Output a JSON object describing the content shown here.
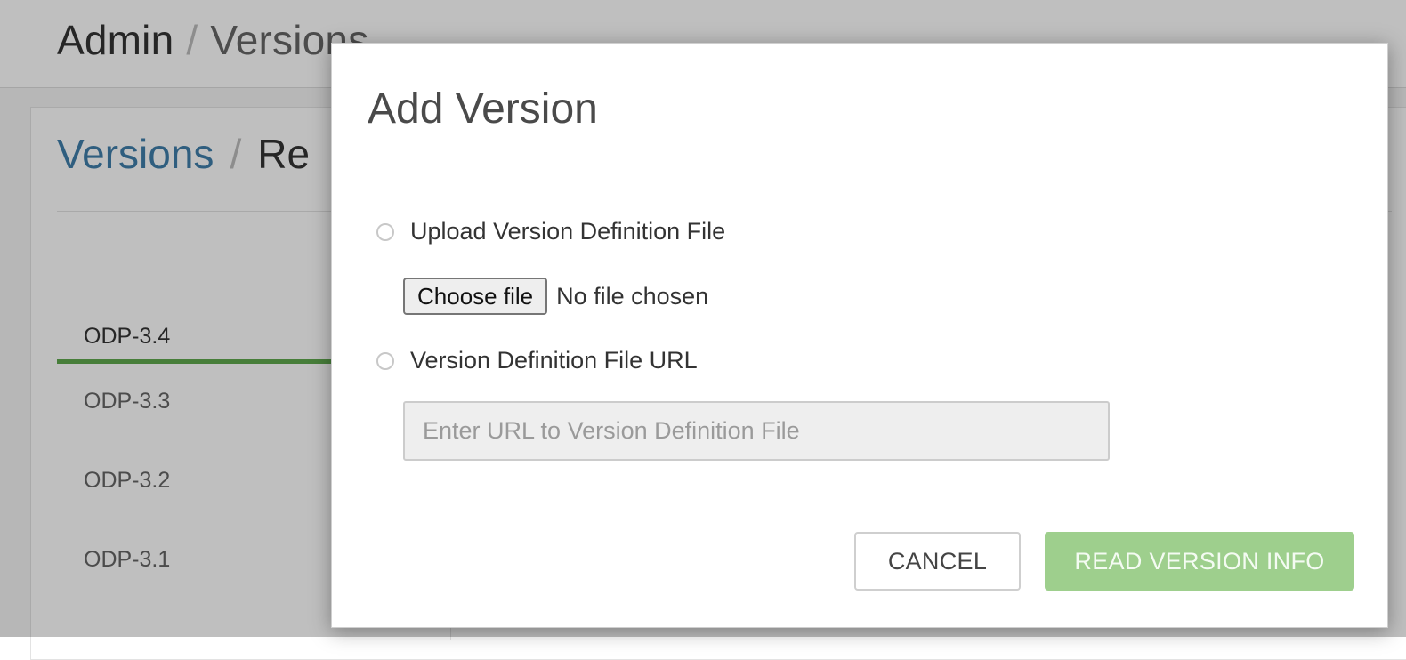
{
  "header": {
    "crumb_root": "Admin",
    "crumb_separator": "/",
    "crumb_current": "Versions"
  },
  "panel": {
    "crumb_link": "Versions",
    "crumb_separator": "/",
    "crumb_current": "Re"
  },
  "stack_tabs": [
    {
      "label": "ODP-3.4",
      "active": true
    },
    {
      "label": "ODP-3.3",
      "active": false
    },
    {
      "label": "ODP-3.2",
      "active": false
    },
    {
      "label": "ODP-3.1",
      "active": false
    }
  ],
  "modal": {
    "title": "Add Version",
    "option_upload_label": "Upload Version Definition File",
    "choose_file_label": "Choose file",
    "file_status": "No file chosen",
    "option_url_label": "Version Definition File URL",
    "url_placeholder": "Enter URL to Version Definition File",
    "url_value": "",
    "cancel_label": "CANCEL",
    "read_label": "READ VERSION INFO"
  },
  "colors": {
    "accent_green": "#5fa84e",
    "primary_button_disabled": "#9ecf8d",
    "link_blue": "#3f7eaa"
  }
}
